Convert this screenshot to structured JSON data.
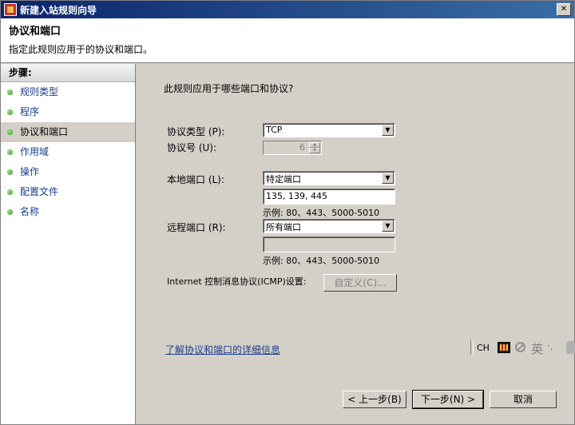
{
  "window": {
    "title": "新建入站规则向导",
    "close_glyph": "✕"
  },
  "header": {
    "title": "协议和端口",
    "subtitle": "指定此规则应用于的协议和端口。"
  },
  "steps": {
    "heading": "步骤:",
    "items": [
      {
        "label": "规则类型",
        "active": false
      },
      {
        "label": "程序",
        "active": false
      },
      {
        "label": "协议和端口",
        "active": true
      },
      {
        "label": "作用域",
        "active": false
      },
      {
        "label": "操作",
        "active": false
      },
      {
        "label": "配置文件",
        "active": false
      },
      {
        "label": "名称",
        "active": false
      }
    ]
  },
  "form": {
    "question": "此规则应用于哪些端口和协议?",
    "protocol_type_label": "协议类型 (P):",
    "protocol_type_value": "TCP",
    "protocol_number_label": "协议号 (U):",
    "protocol_number_value": "6",
    "local_port_label": "本地端口 (L):",
    "local_port_select": "特定端口",
    "local_port_value": "135, 139, 445",
    "local_port_example": "示例: 80、443、5000-5010",
    "remote_port_label": "远程端口 (R):",
    "remote_port_select": "所有端口",
    "remote_port_value": "",
    "remote_port_example": "示例: 80、443、5000-5010",
    "icmp_label": "Internet 控制消息协议(ICMP)设置:",
    "customize_button": "自定义(C)...",
    "learn_more_link": "了解协议和端口的详细信息"
  },
  "buttons": {
    "back": "< 上一步(B)",
    "next": "下一步(N) >",
    "cancel": "取消"
  },
  "language_bar": {
    "lang": "CH",
    "ime_label": "英",
    "dots": "·,"
  },
  "colors": {
    "title_bar": "#0a246a",
    "link": "#1a3e8c",
    "face": "#d4d0c8"
  }
}
